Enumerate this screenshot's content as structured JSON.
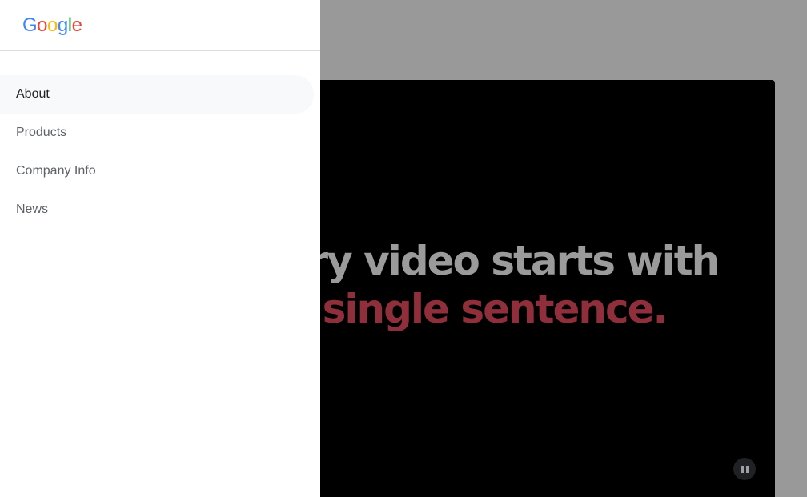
{
  "logo": {
    "letters": [
      "G",
      "o",
      "o",
      "g",
      "l",
      "e"
    ],
    "colors": {
      "blue": "#4285f4",
      "red": "#ea4335",
      "yellow": "#fbbc05",
      "green": "#34a853"
    }
  },
  "drawer": {
    "items": [
      {
        "label": "About",
        "active": true
      },
      {
        "label": "Products",
        "active": false
      },
      {
        "label": "Company Info",
        "active": false
      },
      {
        "label": "News",
        "active": false
      }
    ]
  },
  "video": {
    "headline_line1": "Every video starts with",
    "headline_line2": "a single sentence.",
    "headline_color": "#9b9b9b",
    "accent_color": "#8f2f3b",
    "control_icon": "pause-icon"
  }
}
